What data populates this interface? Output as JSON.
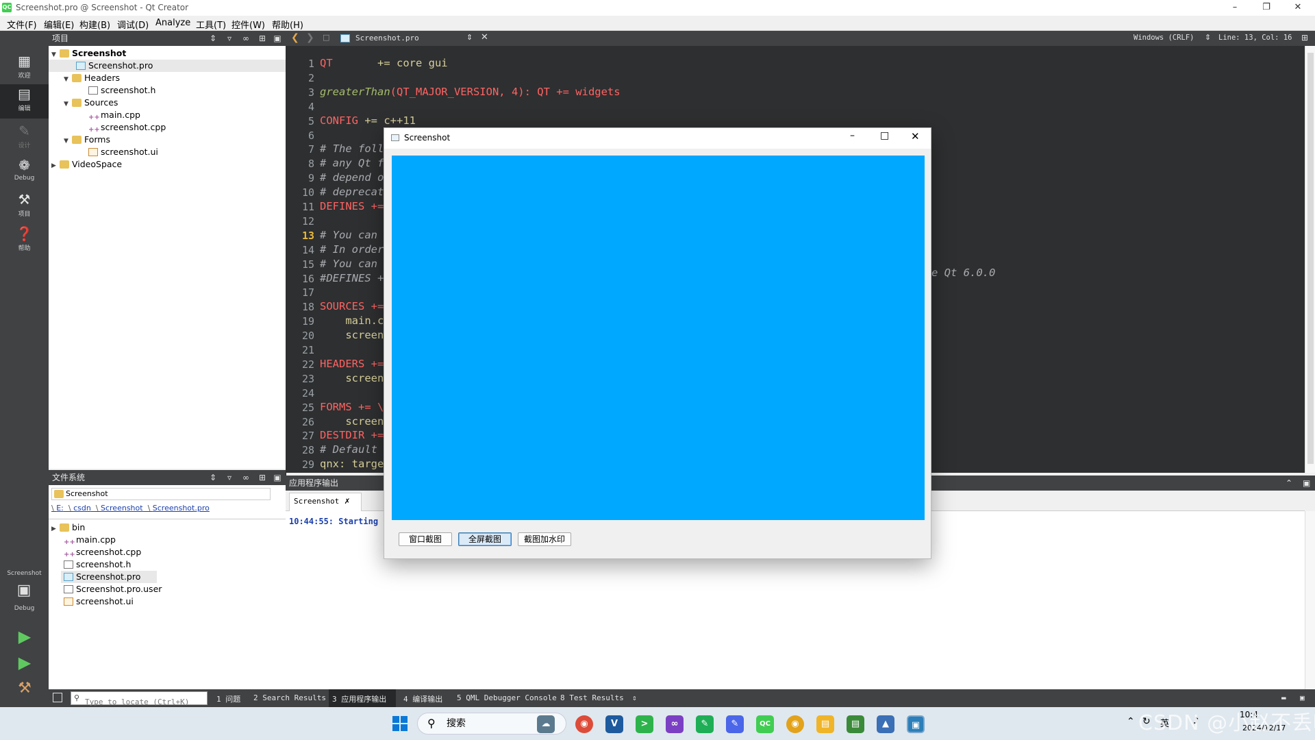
{
  "titlebar": {
    "title": "Screenshot.pro @ Screenshot - Qt Creator",
    "logo": "QC"
  },
  "menu": [
    "文件(F)",
    "编辑(E)",
    "构建(B)",
    "调试(D)",
    "Analyze",
    "工具(T)",
    "控件(W)",
    "帮助(H)"
  ],
  "modes": [
    {
      "label": "欢迎",
      "icon": "grid-icon"
    },
    {
      "label": "编辑",
      "icon": "edit-icon"
    },
    {
      "label": "设计",
      "icon": "pencil-icon"
    },
    {
      "label": "Debug",
      "icon": "bug-icon"
    },
    {
      "label": "项目",
      "icon": "wrench-icon"
    },
    {
      "label": "帮助",
      "icon": "help-icon"
    }
  ],
  "target": {
    "name": "Screenshot",
    "mode": "Debug"
  },
  "projects": {
    "header": "项目",
    "items": [
      {
        "label": "Screenshot",
        "bold": true
      },
      {
        "label": "Screenshot.pro"
      },
      {
        "label": "Headers"
      },
      {
        "label": "screenshot.h"
      },
      {
        "label": "Sources"
      },
      {
        "label": "main.cpp"
      },
      {
        "label": "screenshot.cpp"
      },
      {
        "label": "Forms"
      },
      {
        "label": "screenshot.ui"
      },
      {
        "label": "VideoSpace"
      }
    ]
  },
  "filesystem": {
    "header": "文件系统",
    "root": "Screenshot",
    "path": [
      "E:",
      "csdn",
      "Screenshot",
      "Screenshot.pro"
    ],
    "items": [
      "bin",
      "main.cpp",
      "screenshot.cpp",
      "screenshot.h",
      "Screenshot.pro",
      "Screenshot.pro.user",
      "screenshot.ui"
    ]
  },
  "editor": {
    "file": "Screenshot.pro",
    "encoding": "Windows (CRLF)",
    "position": "Line: 13, Col: 16",
    "current_line": "13",
    "lines": [
      {
        "n": "1",
        "parts": [
          [
            "kw",
            "QT"
          ],
          [
            "df",
            "       += core gui"
          ]
        ]
      },
      {
        "n": "2",
        "parts": []
      },
      {
        "n": "3",
        "parts": [
          [
            "fn",
            "greaterThan"
          ],
          [
            "kw",
            "(QT_MAJOR_VERSION, 4): QT += widgets"
          ]
        ]
      },
      {
        "n": "4",
        "parts": []
      },
      {
        "n": "5",
        "parts": [
          [
            "kw",
            "CONFIG"
          ],
          [
            "df",
            " += c++11"
          ]
        ]
      },
      {
        "n": "6",
        "parts": []
      },
      {
        "n": "7",
        "parts": [
          [
            "cm",
            "# The foll"
          ]
        ]
      },
      {
        "n": "8",
        "parts": [
          [
            "cm",
            "# any Qt f"
          ]
        ]
      },
      {
        "n": "9",
        "parts": [
          [
            "cm",
            "# depend o"
          ]
        ]
      },
      {
        "n": "10",
        "parts": [
          [
            "cm",
            "# deprecat"
          ]
        ]
      },
      {
        "n": "11",
        "parts": [
          [
            "kw",
            "DEFINES +="
          ]
        ]
      },
      {
        "n": "12",
        "parts": []
      },
      {
        "n": "13",
        "parts": [
          [
            "cm",
            "# You can "
          ]
        ]
      },
      {
        "n": "14",
        "parts": [
          [
            "cm",
            "# In order"
          ]
        ]
      },
      {
        "n": "15",
        "parts": [
          [
            "cm",
            "# You can "
          ]
        ]
      },
      {
        "n": "16",
        "parts": [
          [
            "cm",
            "#DEFINES +"
          ]
        ]
      },
      {
        "n": "17",
        "parts": []
      },
      {
        "n": "18",
        "parts": [
          [
            "kw",
            "SOURCES +="
          ]
        ]
      },
      {
        "n": "19",
        "parts": [
          [
            "df",
            "    main.c"
          ]
        ]
      },
      {
        "n": "20",
        "parts": [
          [
            "df",
            "    screen"
          ]
        ]
      },
      {
        "n": "21",
        "parts": []
      },
      {
        "n": "22",
        "parts": [
          [
            "kw",
            "HEADERS +="
          ]
        ]
      },
      {
        "n": "23",
        "parts": [
          [
            "df",
            "    screen"
          ]
        ]
      },
      {
        "n": "24",
        "parts": []
      },
      {
        "n": "25",
        "parts": [
          [
            "kw",
            "FORMS += \\"
          ]
        ]
      },
      {
        "n": "26",
        "parts": [
          [
            "df",
            "    screen"
          ]
        ]
      },
      {
        "n": "27",
        "parts": [
          [
            "kw",
            "DESTDIR +="
          ]
        ]
      },
      {
        "n": "28",
        "parts": [
          [
            "cm",
            "# Default "
          ]
        ]
      },
      {
        "n": "29",
        "parts": [
          [
            "df",
            "qnx: targe"
          ]
        ]
      }
    ],
    "fragment_16": "e Qt 6.0.0"
  },
  "output": {
    "header": "应用程序输出",
    "tab": "Screenshot",
    "line": "10:44:55: Starting"
  },
  "statusbar": {
    "locate_placeholder": "Type to locate (Ctrl+K)",
    "tabs": [
      "1 问题",
      "2 Search Results",
      "3 应用程序输出",
      "4 编译输出",
      "5 QML Debugger Console",
      "8 Test Results"
    ]
  },
  "window": {
    "title": "Screenshot",
    "canvas_color": "#00a8ff",
    "buttons": [
      "窗口截图",
      "全屏截图",
      "截图加水印"
    ]
  },
  "taskbar": {
    "search": "搜索",
    "clock_time": "10:4",
    "clock_date": "2024/12/17",
    "watermark": "CSDN @小赵不丢啦",
    "ime": "英"
  }
}
